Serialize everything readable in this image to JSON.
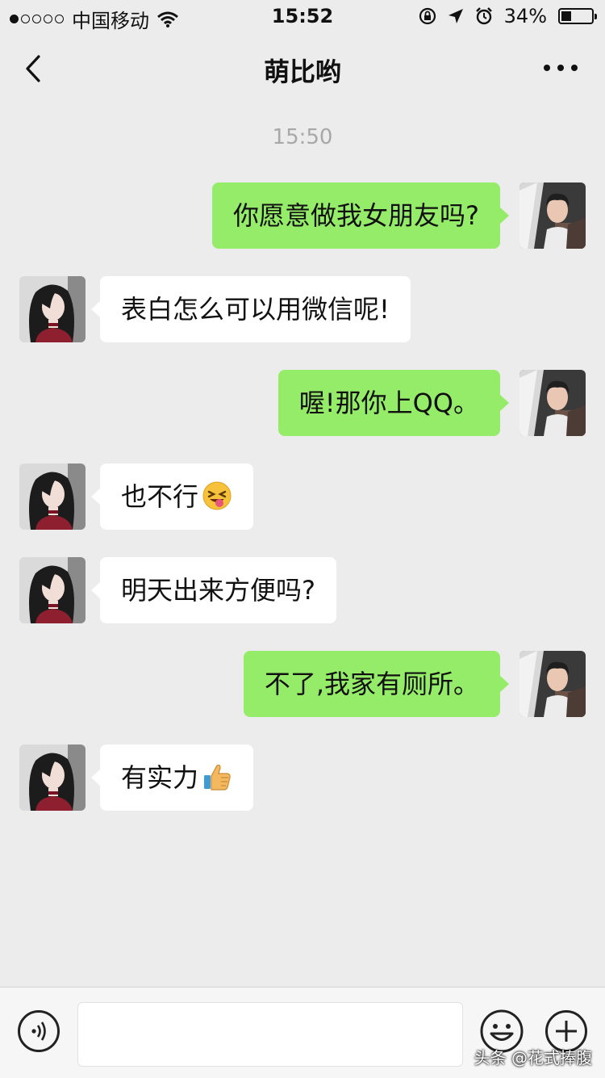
{
  "status_bar": {
    "carrier": "中国移动",
    "time": "15:52",
    "battery": "34%",
    "battery_level": 0.34,
    "signal_bars_filled": 1,
    "signal_bars_total": 5
  },
  "nav": {
    "title": "萌比哟",
    "back_icon": "chevron-left-icon",
    "more_icon": "more-dots-icon"
  },
  "chat": {
    "timestamp": "15:50",
    "messages": [
      {
        "side": "right",
        "text": "你愿意做我女朋友吗?"
      },
      {
        "side": "left",
        "text": "表白怎么可以用微信呢!"
      },
      {
        "side": "right",
        "text": "喔!那你上QQ。"
      },
      {
        "side": "left",
        "text": "也不行",
        "emoji": "tongue-out-emoji"
      },
      {
        "side": "left",
        "text": "明天出来方便吗?"
      },
      {
        "side": "right",
        "text": "不了,我家有厕所。"
      },
      {
        "side": "left",
        "text": "有实力",
        "emoji": "thumbs-up-emoji"
      }
    ]
  },
  "input_bar": {
    "voice_icon": "voice-icon",
    "emoji_icon": "emoji-icon",
    "plus_icon": "plus-icon"
  },
  "watermark": "头条 @花式捧腹",
  "colors": {
    "background": "#ececec",
    "sent_bubble": "#95ec69",
    "received_bubble": "#ffffff"
  }
}
